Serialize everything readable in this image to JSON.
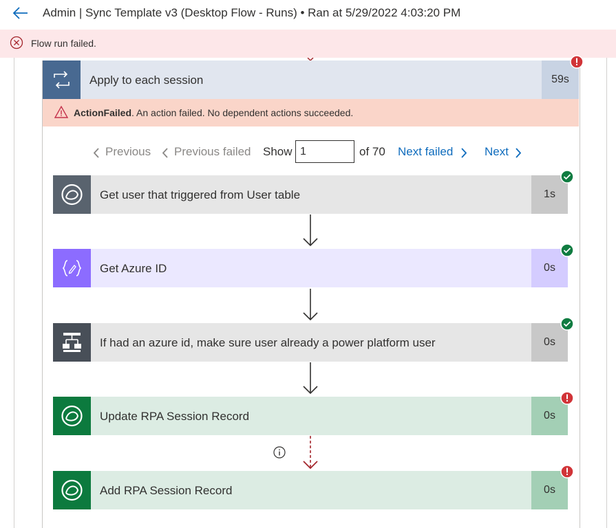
{
  "header": {
    "title": "Admin | Sync Template v3 (Desktop Flow - Runs) • Ran at 5/29/2022 4:03:20 PM",
    "back_icon": "back-arrow-icon"
  },
  "banner": {
    "message": "Flow run failed.",
    "icon": "error-circle-icon",
    "color": "#fde7e9"
  },
  "loop": {
    "title": "Apply to each session",
    "duration": "59s",
    "icon": "loop-icon",
    "status": "failed",
    "error": {
      "code": "ActionFailed",
      "message": ". An action failed. No dependent actions succeeded."
    }
  },
  "pager": {
    "previous": "Previous",
    "previous_failed": "Previous failed",
    "show": "Show",
    "current": "1",
    "of_total": "of 70",
    "next_failed": "Next failed",
    "next": "Next"
  },
  "actions": [
    {
      "label": "Get user that triggered from User table",
      "duration": "1s",
      "status": "succeeded",
      "icon": "dataverse-icon",
      "icon_bg": "#59636e",
      "bg": "#e6e6e6",
      "dur_bg": "#c8c8c8"
    },
    {
      "label": "Get Azure ID",
      "duration": "0s",
      "status": "succeeded",
      "icon": "compose-icon",
      "icon_bg": "#8c6cff",
      "bg": "#ebe8ff",
      "dur_bg": "#d4ccff"
    },
    {
      "label": "If had an azure id, make sure user already a power platform user",
      "duration": "0s",
      "status": "succeeded",
      "icon": "condition-icon",
      "icon_bg": "#484f58",
      "bg": "#e6e6e6",
      "dur_bg": "#c8c8c8"
    },
    {
      "label": "Update RPA Session Record",
      "duration": "0s",
      "status": "failed",
      "icon": "dataverse-icon",
      "icon_bg": "#0c7a3e",
      "bg": "#dcece3",
      "dur_bg": "#a3cfb5"
    },
    {
      "label": "Add RPA Session Record",
      "duration": "0s",
      "status": "failed",
      "icon": "dataverse-icon",
      "icon_bg": "#0c7a3e",
      "bg": "#dcece3",
      "dur_bg": "#a3cfb5"
    }
  ],
  "colors": {
    "success": "#107c41",
    "failure": "#d13438",
    "link": "#0f6cbd"
  }
}
